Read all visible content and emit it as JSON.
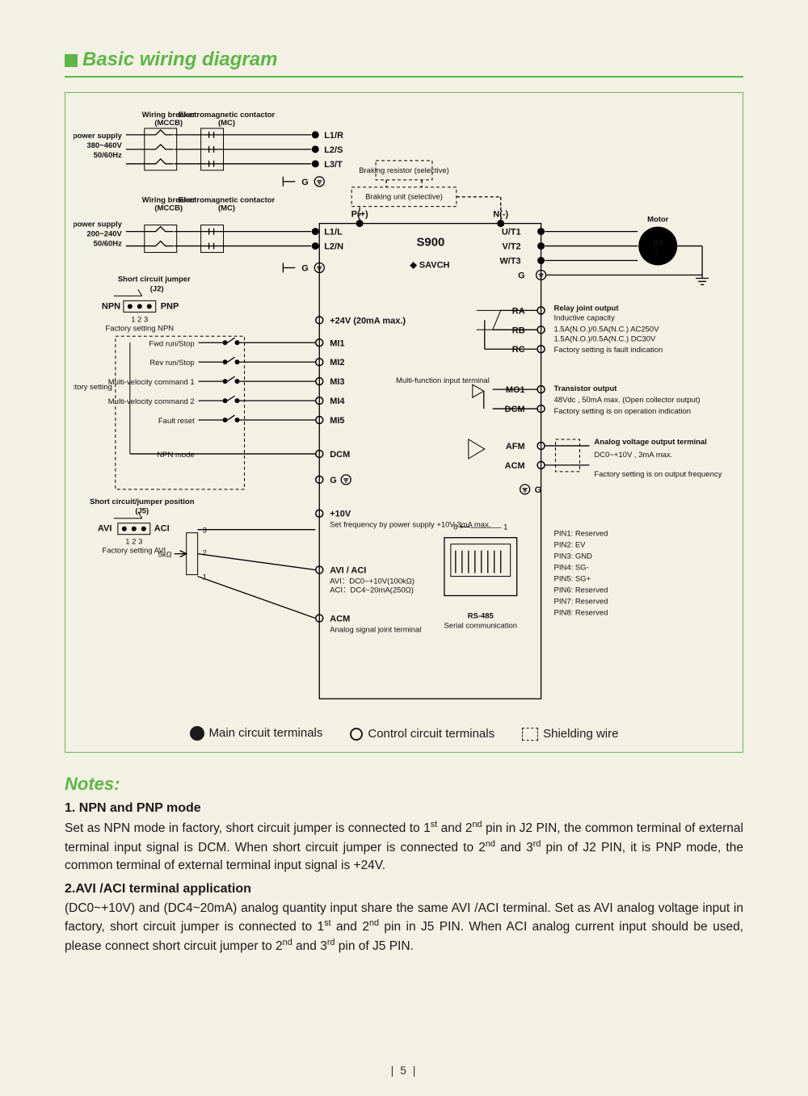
{
  "title": "Basic wiring diagram",
  "product": "S900",
  "brand": "SAVCH",
  "powerSupplies": {
    "threePhase": {
      "label": "Three phase AC power supply",
      "voltage": "380~460V",
      "freq": "50/60Hz",
      "phases": [
        "L1/R",
        "L2/S",
        "L3/T"
      ]
    },
    "singlePhase": {
      "label": "Single-phase AC power supply",
      "voltage": "200~240V",
      "freq": "50/60Hz",
      "phases": [
        "L1/L",
        "L2/N"
      ]
    }
  },
  "breakers": {
    "header1": "Wiring breaker",
    "header1b": "(MCCB)",
    "header2": "Electromagnetic contactor",
    "header2b": "(MC)"
  },
  "dcBus": {
    "p": "P(+)",
    "n": "N(-)",
    "brakingUnit": "Braking unit (selective)",
    "brakingRes": "Braking resistor (selective)"
  },
  "motor": {
    "label": "Motor",
    "im": "IM",
    "poles": "3~",
    "terminals": [
      "U/T1",
      "V/T2",
      "W/T3"
    ]
  },
  "groundLabel": "G",
  "jumperJ2": {
    "label": "Short circuit jumper",
    "name": "(J2)",
    "left": "NPN",
    "right": "PNP",
    "pins": "1 2 3",
    "factory": "Factory setting NPN"
  },
  "controlInputs": {
    "supply": "+24V (20mA max.)",
    "items": [
      "Fwd run/Stop",
      "Rev run/Stop",
      "Multi-velocity command 1",
      "Multi-velocity command 2",
      "Fault reset",
      "NPN mode"
    ],
    "factoryLabel": "Factory setting",
    "terminals": [
      "MI1",
      "MI2",
      "MI3",
      "MI4",
      "MI5"
    ],
    "desc": "Multi-function input terminal",
    "dcm": "DCM"
  },
  "jumperJ5": {
    "label": "Short circuit/jumper position",
    "name": "(J5)",
    "left": "AVI",
    "right": "ACI",
    "pins": "1 2 3",
    "factory": "Factory setting AVI",
    "pot": "5kΩ",
    "potPins": [
      "3",
      "2",
      "1"
    ]
  },
  "analogIn": {
    "plus10v": "+10V",
    "plus10vDesc": "Set frequency by power supply +10V 3mA max.",
    "aviaci": "AVI / ACI",
    "aviDesc": "AVI：DC0~+10V(100kΩ)",
    "aciDesc": "ACI：DC4~20mA(250Ω)",
    "acm": "ACM",
    "acmDesc": "Analog signal joint terminal"
  },
  "relay": {
    "terminals": [
      "RA",
      "RB",
      "RC"
    ],
    "title": "Relay joint output",
    "title2": "Inductive capacity",
    "rating1": "1.5A(N.O.)/0.5A(N.C.) AC250V",
    "rating2": "1.5A(N.O.)/0.5A(N.C.) DC30V",
    "factory": "Factory setting is fault indication"
  },
  "transistor": {
    "mo1": "MO1",
    "dcm": "DCM",
    "title": "Transistor output",
    "rating": "48Vdc , 50mA max. (Open collector output)",
    "factory": "Factory setting is on operation indication"
  },
  "analogOut": {
    "afm": "AFM",
    "acm": "ACM",
    "title": "Analog voltage output terminal",
    "rating": "DC0~+10V , 3mA max.",
    "factory": "Factory setting is on output frequency"
  },
  "rj45": {
    "label": "RS-485",
    "sub": "Serial communication",
    "pinHeader": "8 ⟵———— 1",
    "pins": [
      "PIN1: Reserved",
      "PIN2: EV",
      "PIN3: GND",
      "PIN4: SG-",
      "PIN5: SG+",
      "PIN6: Reserved",
      "PIN7: Reserved",
      "PIN8: Reserved"
    ]
  },
  "legend": {
    "main": "Main circuit terminals",
    "control": "Control circuit terminals",
    "shield": "Shielding wire"
  },
  "notesHeading": "Notes:",
  "notes": [
    {
      "title": "1. NPN and PNP mode",
      "body": "Set as NPN mode in factory, short circuit jumper is connected to 1st and 2nd pin in J2 PIN, the common terminal of external terminal input signal is DCM. When short circuit jumper is connected to 2nd and 3rd pin of J2 PIN, it is PNP mode, the common terminal of external terminal input signal is +24V."
    },
    {
      "title": "2.AVI /ACI terminal application",
      "body": "(DC0~+10V) and (DC4~20mA) analog quantity input share the same AVI /ACI terminal. Set as AVI analog voltage input in factory, short circuit jumper is connected to 1st and 2nd pin in J5 PIN. When ACI analog current input should be used, please connect short circuit jumper to 2nd and 3rd pin of J5 PIN."
    }
  ],
  "pageNumber": "5"
}
